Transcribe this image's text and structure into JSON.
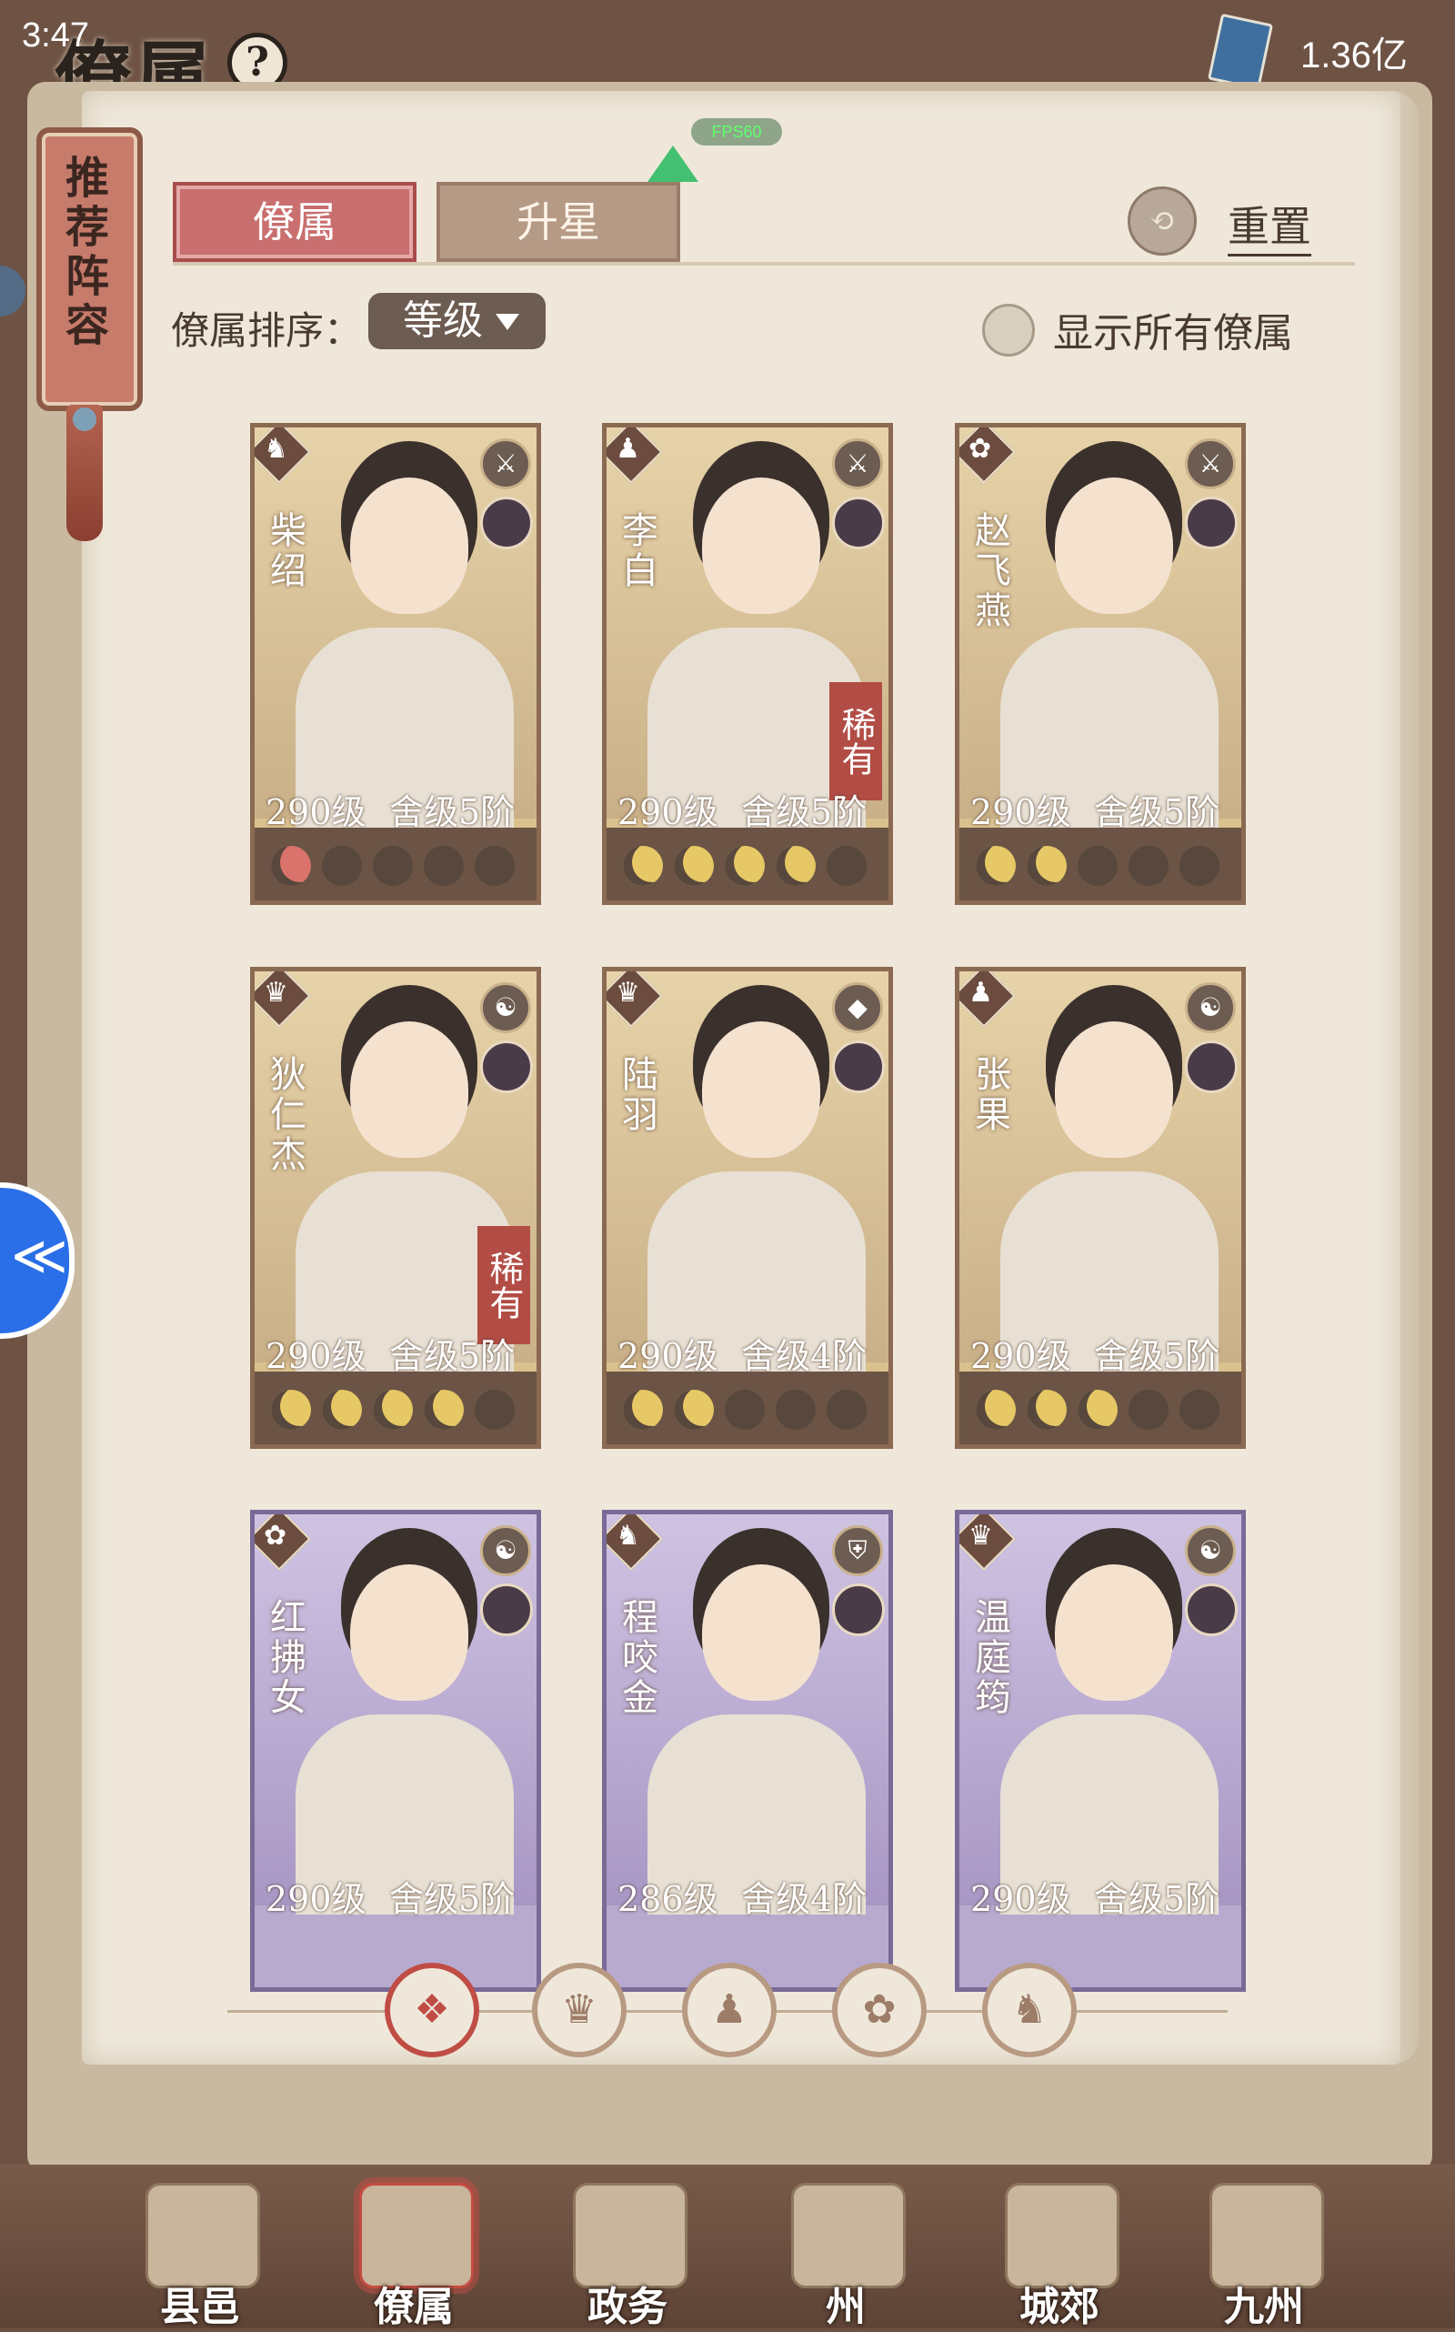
{
  "status": {
    "time": "3:47",
    "money": "1.36亿"
  },
  "header": {
    "title": "僚属",
    "help_glyph": "?"
  },
  "scroll": {
    "label": "推荐阵容"
  },
  "fps": "FPS60",
  "tabs": [
    {
      "label": "僚属",
      "active": true
    },
    {
      "label": "升星",
      "active": false
    }
  ],
  "reset": {
    "label": "重置"
  },
  "sort": {
    "label": "僚属排序：",
    "value": "等级"
  },
  "show_all": {
    "label": "显示所有僚属",
    "checked": false
  },
  "cards": [
    {
      "name": "柴绍",
      "level": "290级",
      "rank": "舍级5阶",
      "rare": "",
      "stars": 1,
      "color": "gold",
      "class_glyph": "♞",
      "faction_glyph": "⚔"
    },
    {
      "name": "李白",
      "level": "290级",
      "rank": "舍级5阶",
      "rare": "稀有",
      "stars": 4,
      "color": "gold",
      "class_glyph": "♟",
      "faction_glyph": "⚔"
    },
    {
      "name": "赵飞燕",
      "level": "290级",
      "rank": "舍级5阶",
      "rare": "",
      "stars": 2,
      "color": "gold",
      "class_glyph": "✿",
      "faction_glyph": "⚔"
    },
    {
      "name": "狄仁杰",
      "level": "290级",
      "rank": "舍级5阶",
      "rare": "稀有",
      "stars": 4,
      "color": "gold",
      "class_glyph": "♛",
      "faction_glyph": "☯"
    },
    {
      "name": "陆羽",
      "level": "290级",
      "rank": "舍级4阶",
      "rare": "",
      "stars": 2,
      "color": "gold",
      "class_glyph": "♛",
      "faction_glyph": "◆"
    },
    {
      "name": "张果",
      "level": "290级",
      "rank": "舍级5阶",
      "rare": "",
      "stars": 3,
      "color": "gold",
      "class_glyph": "♟",
      "faction_glyph": "☯"
    },
    {
      "name": "红拂女",
      "level": "290级",
      "rank": "舍级5阶",
      "rare": "",
      "stars": 0,
      "color": "purple",
      "class_glyph": "✿",
      "faction_glyph": "☯"
    },
    {
      "name": "程咬金",
      "level": "286级",
      "rank": "舍级4阶",
      "rare": "",
      "stars": 0,
      "color": "purple",
      "class_glyph": "♞",
      "faction_glyph": "⛨"
    },
    {
      "name": "温庭筠",
      "level": "290级",
      "rank": "舍级5阶",
      "rare": "",
      "stars": 0,
      "color": "purple",
      "class_glyph": "♛",
      "faction_glyph": "☯"
    }
  ],
  "filters": [
    {
      "icon": "all-diamond-icon",
      "glyph": "❖",
      "active": true
    },
    {
      "icon": "official-hat-icon",
      "glyph": "♛",
      "active": false
    },
    {
      "icon": "gourd-icon",
      "glyph": "♟",
      "active": false
    },
    {
      "icon": "fan-icon",
      "glyph": "✿",
      "active": false
    },
    {
      "icon": "horse-icon",
      "glyph": "♞",
      "active": false
    }
  ],
  "bottom_nav": [
    {
      "label": "县邑",
      "active": false
    },
    {
      "label": "僚属",
      "active": true
    },
    {
      "label": "政务",
      "active": false
    },
    {
      "label": "州",
      "active": false
    },
    {
      "label": "城郊",
      "active": false
    },
    {
      "label": "九州",
      "active": false
    }
  ],
  "colors": {
    "accent_red": "#c96f6f",
    "card_gold": "#d9c28f",
    "card_purple": "#b8aacf",
    "moon_on": "#e6c866"
  }
}
